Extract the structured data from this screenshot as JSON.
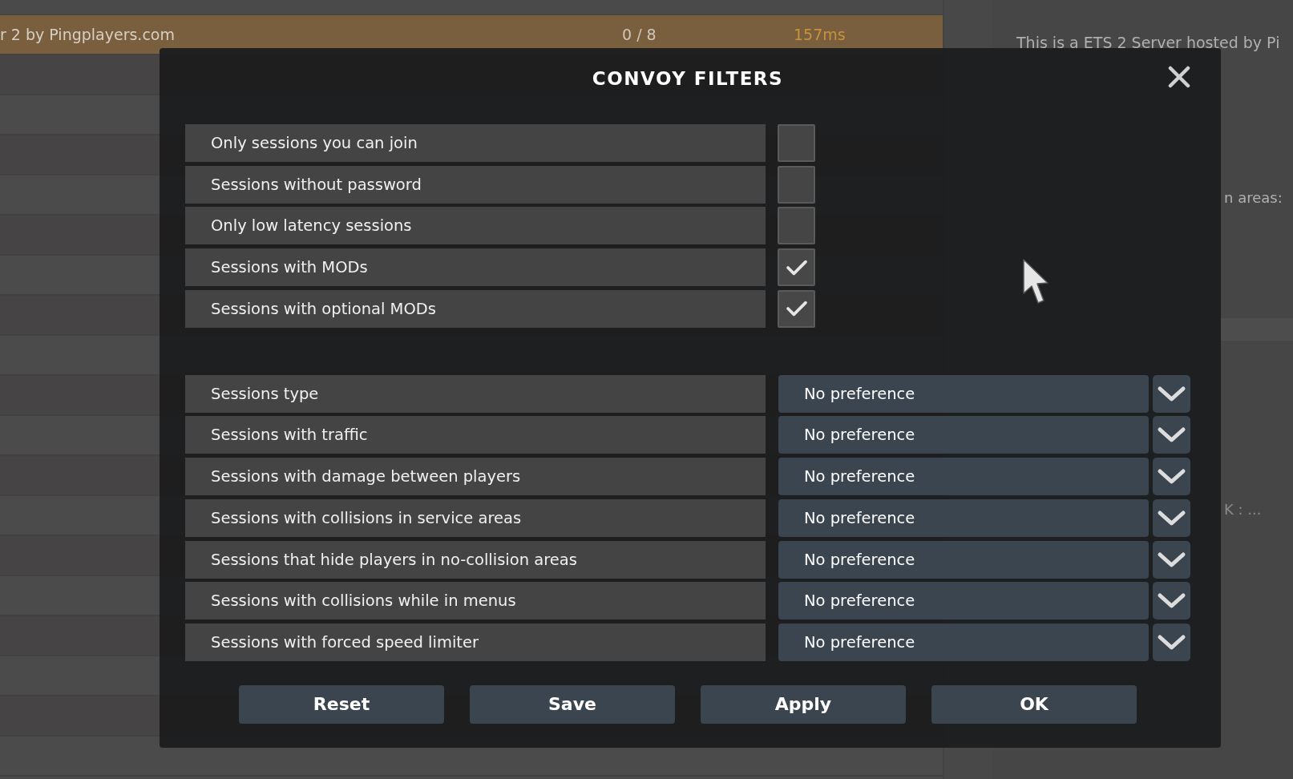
{
  "server_row": {
    "name": "r 2 by Pingplayers.com",
    "players": "0 / 8",
    "ping": "157ms"
  },
  "server_info": {
    "description": "This is a ETS 2 Server hosted by Pi",
    "setting_fragment": "n areas:",
    "dlc_fragment": "K : ..."
  },
  "dialog": {
    "title": "CONVOY FILTERS",
    "checkbox_filters": [
      {
        "label": "Only sessions you can join",
        "checked": false
      },
      {
        "label": "Sessions without password",
        "checked": false
      },
      {
        "label": "Only low latency sessions",
        "checked": false
      },
      {
        "label": "Sessions with MODs",
        "checked": true
      },
      {
        "label": "Sessions with optional MODs",
        "checked": true
      }
    ],
    "dropdown_filters": [
      {
        "label": "Sessions type",
        "value": "No preference"
      },
      {
        "label": "Sessions with traffic",
        "value": "No preference"
      },
      {
        "label": "Sessions with damage between players",
        "value": "No preference"
      },
      {
        "label": "Sessions with collisions in service areas",
        "value": "No preference"
      },
      {
        "label": "Sessions that hide players in no-collision areas",
        "value": "No preference"
      },
      {
        "label": "Sessions with collisions while in menus",
        "value": "No preference"
      },
      {
        "label": "Sessions with forced speed limiter",
        "value": "No preference"
      }
    ],
    "buttons": [
      "Reset",
      "Save",
      "Apply",
      "OK"
    ]
  }
}
